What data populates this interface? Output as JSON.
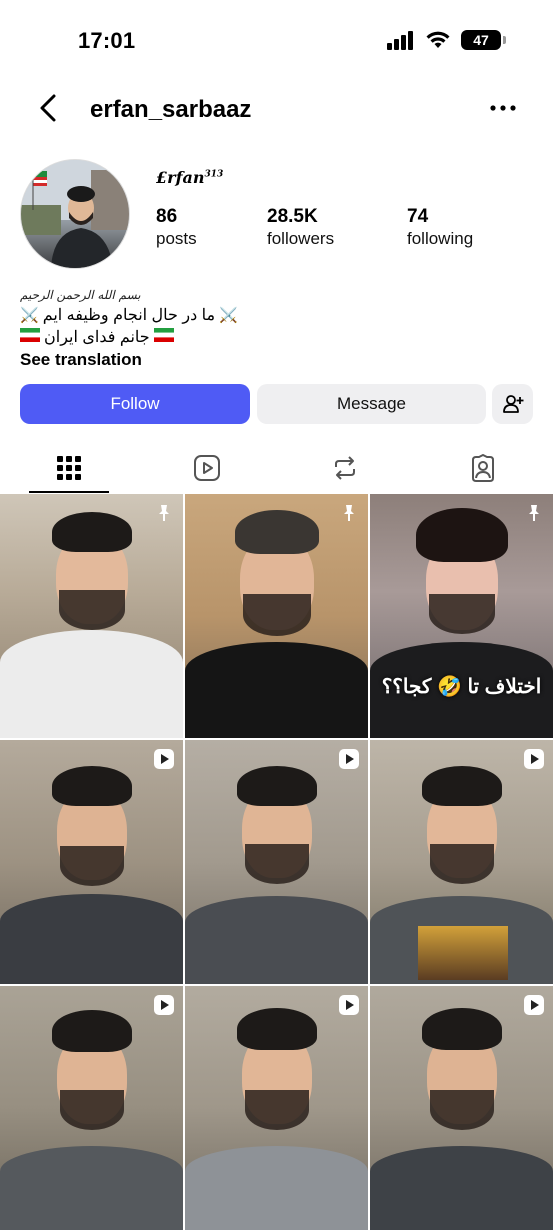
{
  "status_bar": {
    "time": "17:01",
    "battery": "47"
  },
  "header": {
    "username": "erfan_sarbaaz"
  },
  "profile": {
    "display_name": "£rfan",
    "display_name_sup": "313",
    "stats": [
      {
        "value": "86",
        "label": "posts"
      },
      {
        "value": "28.5K",
        "label": "followers"
      },
      {
        "value": "74",
        "label": "following"
      }
    ],
    "bio": {
      "bismillah": "بسم الله الرحمن الرحیم",
      "line1": "ما در حال انجام وظیفه ایم",
      "line2": "جانم فدای ایران",
      "see_translation": "See translation"
    }
  },
  "actions": {
    "follow": "Follow",
    "message": "Message"
  },
  "tabs": [
    "grid-icon",
    "reels-icon",
    "reposts-icon",
    "tagged-icon"
  ],
  "posts": [
    {
      "badge": "pin",
      "caption": ""
    },
    {
      "badge": "pin",
      "caption": ""
    },
    {
      "badge": "pin",
      "caption": "اختلاف تا 🤣 کجا؟؟"
    },
    {
      "badge": "reel",
      "caption": ""
    },
    {
      "badge": "reel",
      "caption": ""
    },
    {
      "badge": "reel",
      "caption": ""
    },
    {
      "badge": "reel",
      "caption": ""
    },
    {
      "badge": "reel",
      "caption": ""
    },
    {
      "badge": "reel",
      "caption": ""
    }
  ],
  "colors": {
    "follow_button": "#4f5bf5",
    "secondary_button": "#efeff1"
  }
}
